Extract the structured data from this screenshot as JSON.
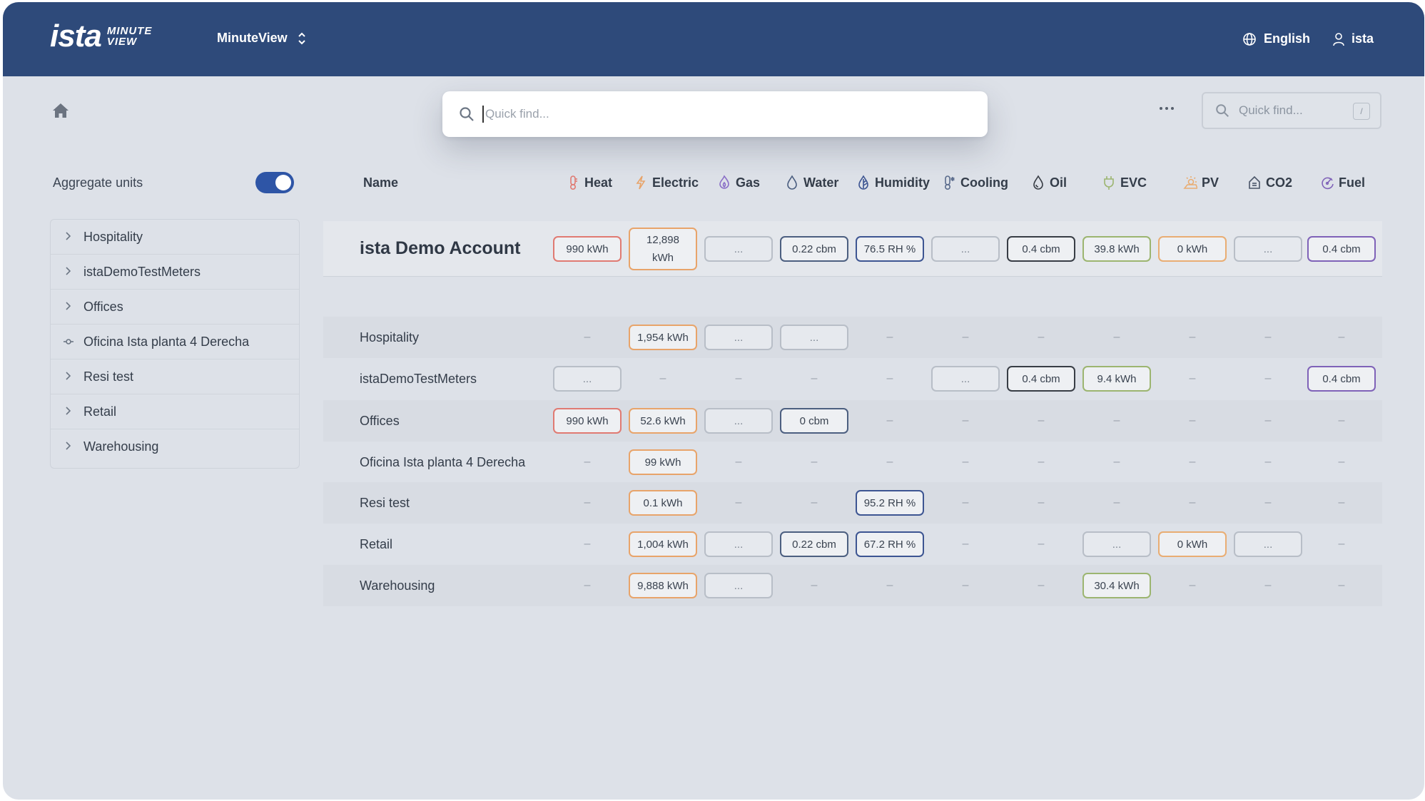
{
  "header": {
    "logo_main": "ista",
    "logo_sub_1": "MINUTE",
    "logo_sub_2": "VIEW",
    "app_name": "MinuteView",
    "language": "English",
    "user": "ista"
  },
  "quick_find_modal": {
    "placeholder": "Quick find..."
  },
  "quick_find_small": {
    "placeholder": "Quick find...",
    "shortcut": "/"
  },
  "sidebar": {
    "aggregate_label": "Aggregate units",
    "aggregate_enabled": true,
    "items": [
      {
        "label": "Hospitality",
        "icon": "chevron-right"
      },
      {
        "label": "istaDemoTestMeters",
        "icon": "chevron-right"
      },
      {
        "label": "Offices",
        "icon": "chevron-right"
      },
      {
        "label": "Oficina Ista planta 4 Derecha",
        "icon": "node"
      },
      {
        "label": "Resi test",
        "icon": "chevron-right"
      },
      {
        "label": "Retail",
        "icon": "chevron-right"
      },
      {
        "label": "Warehousing",
        "icon": "chevron-right"
      }
    ]
  },
  "table": {
    "name_header": "Name",
    "columns": [
      {
        "key": "heat",
        "label": "Heat",
        "icon": "thermometer-icon",
        "color": "#e07a72"
      },
      {
        "key": "electric",
        "label": "Electric",
        "icon": "bolt-icon",
        "color": "#e8a46a"
      },
      {
        "key": "gas",
        "label": "Gas",
        "icon": "flame-icon",
        "color": "#8a6fc7"
      },
      {
        "key": "water",
        "label": "Water",
        "icon": "drop-icon",
        "color": "#4c5f80"
      },
      {
        "key": "humidity",
        "label": "Humidity",
        "icon": "humidity-icon",
        "color": "#3d5592"
      },
      {
        "key": "cooling",
        "label": "Cooling",
        "icon": "cooling-icon",
        "color": "#5a6b8c"
      },
      {
        "key": "oil",
        "label": "Oil",
        "icon": "oil-drop-icon",
        "color": "#383d45"
      },
      {
        "key": "evc",
        "label": "EVC",
        "icon": "plug-icon",
        "color": "#9cb570"
      },
      {
        "key": "pv",
        "label": "PV",
        "icon": "sun-icon",
        "color": "#e9ad73"
      },
      {
        "key": "co2",
        "label": "CO2",
        "icon": "house-icon",
        "color": "#4a5568"
      },
      {
        "key": "fuel",
        "label": "Fuel",
        "icon": "gauge-icon",
        "color": "#7f62b8"
      }
    ],
    "account": {
      "name": "ista Demo Account",
      "cells": [
        "990 kWh",
        "12,898 kWh",
        "...",
        "0.22 cbm",
        "76.5 RH %",
        "...",
        "0.4 cbm",
        "39.8 kWh",
        "0 kWh",
        "...",
        "0.4 cbm"
      ]
    },
    "rows": [
      {
        "name": "Hospitality",
        "cells": [
          "–",
          "1,954 kWh",
          "...",
          "...",
          "–",
          "–",
          "–",
          "–",
          "–",
          "–",
          "–"
        ]
      },
      {
        "name": "istaDemoTestMeters",
        "cells": [
          "...",
          "–",
          "–",
          "–",
          "–",
          "...",
          "0.4 cbm",
          "9.4 kWh",
          "–",
          "–",
          "0.4 cbm"
        ]
      },
      {
        "name": "Offices",
        "cells": [
          "990 kWh",
          "52.6 kWh",
          "...",
          "0 cbm",
          "–",
          "–",
          "–",
          "–",
          "–",
          "–",
          "–"
        ]
      },
      {
        "name": "Oficina Ista planta 4 Derecha",
        "cells": [
          "–",
          "99 kWh",
          "–",
          "–",
          "–",
          "–",
          "–",
          "–",
          "–",
          "–",
          "–"
        ]
      },
      {
        "name": "Resi test",
        "cells": [
          "–",
          "0.1 kWh",
          "–",
          "–",
          "95.2 RH %",
          "–",
          "–",
          "–",
          "–",
          "–",
          "–"
        ]
      },
      {
        "name": "Retail",
        "cells": [
          "–",
          "1,004 kWh",
          "...",
          "0.22 cbm",
          "67.2 RH %",
          "–",
          "–",
          "...",
          "0 kWh",
          "...",
          "–"
        ]
      },
      {
        "name": "Warehousing",
        "cells": [
          "–",
          "9,888 kWh",
          "...",
          "–",
          "–",
          "–",
          "–",
          "30.4 kWh",
          "–",
          "–",
          "–"
        ]
      }
    ]
  }
}
